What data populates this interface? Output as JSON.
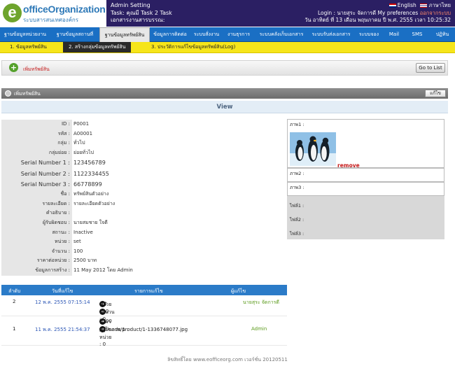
{
  "header": {
    "logo_main": "officeOrganization",
    "logo_sub": "ระบบสารสนเทศองค์กร",
    "admin_line1": "Admin Setting",
    "admin_line2": "Task: คุณมี Task 2 Task",
    "admin_line3": "เอกสารงานสารบรรณ:",
    "lang_en": "English",
    "lang_th": "ภาษาไทย",
    "login_prefix": "Login :",
    "login_user": "นายสุระ จัดการดี",
    "my_pref": "My preferences",
    "logout": "ออกจากระบบ",
    "datetime": "วัน อาทิตย์ ที่ 13 เดือน พฤษภาคม ปี พ.ศ. 2555 เวลา 10:25:32"
  },
  "nav": [
    "ฐานข้อมูลหน่วยงาน",
    "ฐานข้อมูลสถานที่",
    "ฐานข้อมูลทรัพย์สิน",
    "ข้อมูลการติดต่อ",
    "ระบบสั่งงาน",
    "งานธุรการ",
    "ระบบคลังเก็บเอกสาร",
    "ระบบรับส่งเอกสาร",
    "ระบบจอง",
    "Mail",
    "SMS",
    "ปฏิทิน"
  ],
  "subnav": [
    "1. ข้อมูลทรัพย์สิน",
    "2. สร้างกลุ่มข้อมูลทรัพย์สิน",
    "3. ประวัติการแก้ไขข้อมูลทรัพย์สิน(Log)"
  ],
  "action": {
    "add_label": "เพิ่มทรัพย์สิน",
    "goto_label": "Go to List"
  },
  "panel": {
    "title": "เพิ่มทรัพย์สิน",
    "edit_label": "แก้ไข",
    "view_label": "View"
  },
  "info": [
    {
      "label": "ID",
      "value": "P0001"
    },
    {
      "label": "รหัส",
      "value": "A00001"
    },
    {
      "label": "กลุ่ม",
      "value": "ทั่วไป"
    },
    {
      "label": "กลุ่มย่อย",
      "value": "ย่อยทั่วไป"
    },
    {
      "label": "Serial Number 1",
      "value": "123456789"
    },
    {
      "label": "Serial Number 2",
      "value": "1122334455"
    },
    {
      "label": "Serial Number 3",
      "value": "66778899"
    },
    {
      "label": "ชื่อ",
      "value": "ทรัพย์สินตัวอย่าง"
    },
    {
      "label": "รายละเอียด",
      "value": "รายละเอียดตัวอย่าง"
    },
    {
      "label": "คำอธิบาย",
      "value": ""
    },
    {
      "label": "ผู้รับผิดชอบ",
      "value": "นายสมชาย ใจดี"
    },
    {
      "label": "สถานะ",
      "value": "Inactive"
    },
    {
      "label": "หน่วย",
      "value": "set"
    },
    {
      "label": "จำนวน",
      "value": "100"
    },
    {
      "label": "ราคาต่อหน่วย",
      "value": "2500 บาท"
    },
    {
      "label": "ข้อมูลการสร้าง",
      "value": "11 May 2012 โดย Admin"
    }
  ],
  "images": {
    "img1_label": "ภาพ1 :",
    "remove_label": "remove",
    "img2_label": "ภาพ2 :",
    "img3_label": "ภาพ3 :",
    "file1_label": "ไฟล์1 :",
    "file2_label": "ไฟล์2 :",
    "file3_label": "ไฟล์3 :"
  },
  "history": {
    "headers": [
      "ลำดับ",
      "วันที่แก้ไข",
      "รายการแก้ไข",
      "ผู้แก้ไข"
    ],
    "rows": [
      {
        "no": "2",
        "date": "12 พ.ค. 2555 07:15:14",
        "changes": [
          {
            "field": "หน่วย :",
            "from": "",
            "to": "set"
          },
          {
            "field": "จำนวน : 0",
            "from": "",
            "to": "100"
          }
        ],
        "editor": "นายสุระ จัดการดี"
      },
      {
        "no": "1",
        "date": "11 พ.ค. 2555 21:54:37",
        "changes": [
          {
            "field": "ราคาต่อหน่วย : 0",
            "from": "",
            "to": "2500"
          },
          {
            "field": "แก้ไขภาพ 1 :",
            "from": "",
            "to": "/uploads/product/1-1336748077.jpg"
          }
        ],
        "editor": "Admin"
      }
    ]
  },
  "footer": "ลิขสิทธิ์โดย www.eofficeorg.com เวอร์ชั่น 20120511",
  "colors": {
    "header_bg": "#2b1f63",
    "nav_bg": "#1a6fc4",
    "subnav_bg": "#f6e51a",
    "history_header": "#2b7bc8",
    "editor_green": "#5a9a1a"
  }
}
